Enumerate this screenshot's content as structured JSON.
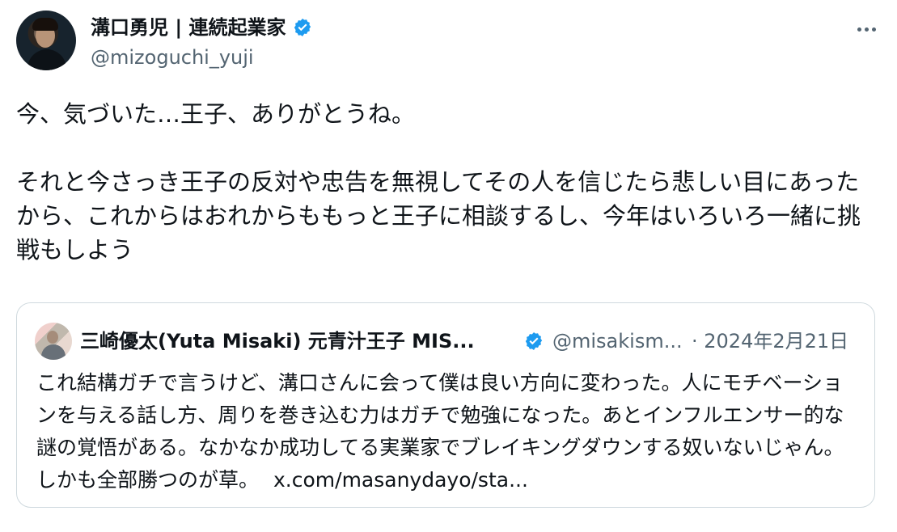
{
  "author": {
    "display_name": "溝口勇児 | 連続起業家",
    "handle": "@mizoguchi_yuji",
    "verified_color": "#1d9bf0"
  },
  "tweet": {
    "text": "今、気づいた…王子、ありがとうね。\n\nそれと今さっき王子の反対や忠告を無視してその人を信じたら悲しい目にあったから、これからはおれからももっと王子に相談するし、今年はいろいろ一緒に挑戦もしよう"
  },
  "quote": {
    "display_name": "三崎優太(Yuta Misaki) 元青汁王子 MIS...",
    "handle": "@misakism...",
    "date": "· 2024年2月21日",
    "text": "これ結構ガチで言うけど、溝口さんに会って僕は良い方向に変わった。人にモチベーションを与える話し方、周りを巻き込む力はガチで勉強になった。あとインフルエンサー的な謎の覚悟がある。なかなか成功してる実業家でブレイキングダウンする奴いないじゃん。しかも全部勝つのが草。",
    "link": "x.com/masanydayo/sta..."
  },
  "icons": {
    "more": "more-horizontal-icon",
    "verified": "verified-badge-icon"
  },
  "colors": {
    "text": "#0f1419",
    "muted": "#536471",
    "border": "#cfd9de",
    "accent": "#1d9bf0"
  }
}
